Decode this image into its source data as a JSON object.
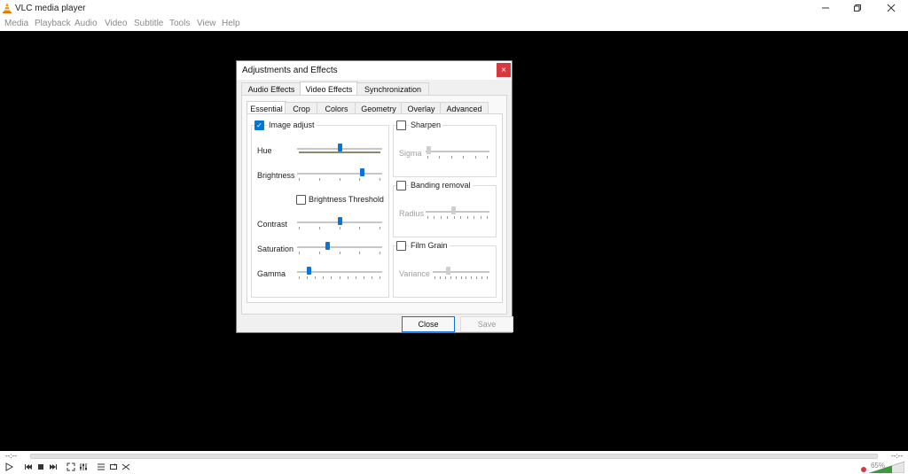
{
  "window": {
    "title": "VLC media player"
  },
  "menu": [
    "Media",
    "Playback",
    "Audio",
    "Video",
    "Subtitle",
    "Tools",
    "View",
    "Help"
  ],
  "player": {
    "time_elapsed": "--:--",
    "time_total": "--:--",
    "volume": "65%"
  },
  "dialog": {
    "title": "Adjustments and Effects",
    "close_glyph": "×",
    "main_tabs": [
      "Audio Effects",
      "Video Effects",
      "Synchronization"
    ],
    "sub_tabs": [
      "Essential",
      "Crop",
      "Colors",
      "Geometry",
      "Overlay",
      "Advanced"
    ],
    "image_adjust": {
      "label": "Image adjust",
      "checked": true,
      "hue_label": "Hue",
      "brightness_label": "Brightness",
      "brightness_threshold_label": "Brightness Threshold",
      "contrast_label": "Contrast",
      "saturation_label": "Saturation",
      "gamma_label": "Gamma",
      "levels": {
        "hue": 0.5,
        "brightness": 0.78,
        "contrast": 0.5,
        "saturation": 0.35,
        "gamma": 0.12
      }
    },
    "sharpen": {
      "label": "Sharpen",
      "sigma_label": "Sigma",
      "level": 0.02
    },
    "banding": {
      "label": "Banding removal",
      "radius_label": "Radius",
      "level": 0.43
    },
    "film_grain": {
      "label": "Film Grain",
      "variance_label": "Variance",
      "level": 0.25
    },
    "buttons": {
      "close": "Close",
      "save": "Save"
    }
  }
}
